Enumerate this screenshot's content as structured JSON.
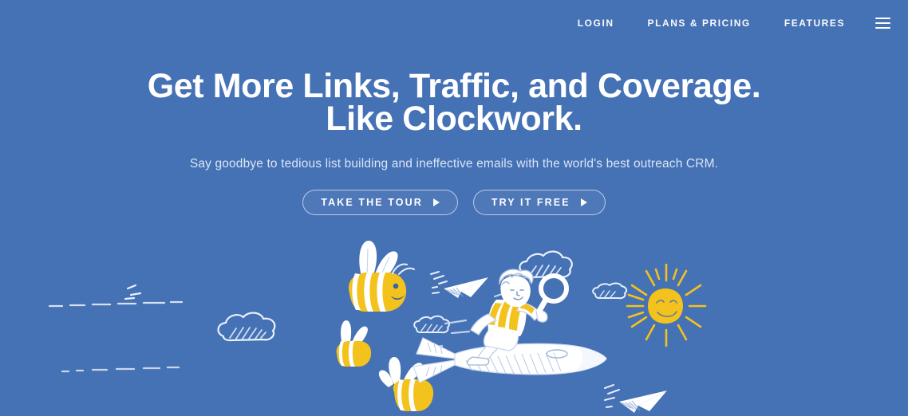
{
  "page": {
    "background_color": "#4571b5",
    "accent_yellow": "#f4c21c",
    "ink_white": "#ffffff"
  },
  "nav": {
    "items": [
      {
        "label": "LOGIN",
        "name": "nav-link-login"
      },
      {
        "label": "PLANS & PRICING",
        "name": "nav-link-plans-pricing"
      },
      {
        "label": "FEATURES",
        "name": "nav-link-features"
      }
    ],
    "menu_icon": "hamburger-menu-icon"
  },
  "hero": {
    "headline_line1": "Get More Links, Traffic, and Coverage.",
    "headline_line2": "Like Clockwork.",
    "subheadline": "Say goodbye to tedious list building and ineffective emails with the world's best outreach CRM."
  },
  "cta": {
    "primary": {
      "label": "TAKE THE TOUR",
      "icon": "play-triangle-icon"
    },
    "secondary": {
      "label": "TRY IT FREE",
      "icon": "play-triangle-icon"
    }
  },
  "illustration": {
    "description": "Hand-drawn sketch scene: a child in a yellow striped shirt holding a magnifying glass rides a rocket across a blue sky, surrounded by bumblebees with dashed flight trails, paper airplanes, sketchy clouds and a yellow sun.",
    "elements": [
      "bee-large",
      "bee-small",
      "bee-bottom",
      "cloud-left",
      "cloud-mid-left",
      "cloud-top",
      "cloud-right",
      "paper-airplane-left",
      "paper-airplane-right",
      "rocket",
      "child-with-magnifying-glass",
      "sun"
    ]
  }
}
